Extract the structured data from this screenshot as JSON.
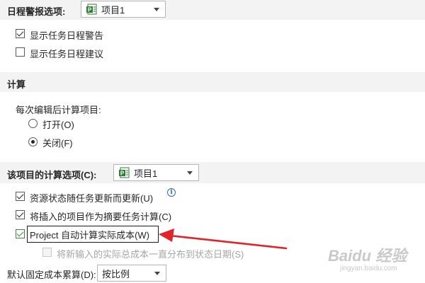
{
  "schedule_alerts": {
    "title": "日程警报选项:",
    "project_dropdown": "项目1",
    "options": [
      {
        "label": "显示任务日程警告",
        "checked": true
      },
      {
        "label": "显示任务日程建议",
        "checked": false
      }
    ]
  },
  "calculation": {
    "title": "计算",
    "subtitle": "每次编辑后计算项目:",
    "radios": [
      {
        "label": "打开(O)",
        "selected": false
      },
      {
        "label": "关闭(F)",
        "selected": true
      }
    ]
  },
  "project_calc": {
    "title": "该项目的计算选项(C):",
    "project_dropdown": "项目1",
    "options": [
      {
        "label": "资源状态随任务更新而更新(U)",
        "checked": true
      },
      {
        "label": "将插入的项目作为摘要任务计算(C)",
        "checked": true
      },
      {
        "label": "Project 自动计算实际成本(W)",
        "checked": true
      },
      {
        "label": "将新输入的实际总成本一直分布到状态日期(S)",
        "checked": false,
        "disabled": true
      }
    ],
    "fixed_cost_label": "默认固定成本累算(D):",
    "fixed_cost_value": "按比例"
  },
  "icons": {
    "project": "project-file-icon",
    "info": "info-icon",
    "annotation": "red-arrow-annotation"
  },
  "colors": {
    "section_band": "#f3f3f3",
    "arrow": "#e0242a",
    "project_icon": "#2e7d32",
    "info": "#2b6cc4"
  },
  "watermark": {
    "logo": "Baidu 经验",
    "url": "jingyan.baidu.com"
  }
}
